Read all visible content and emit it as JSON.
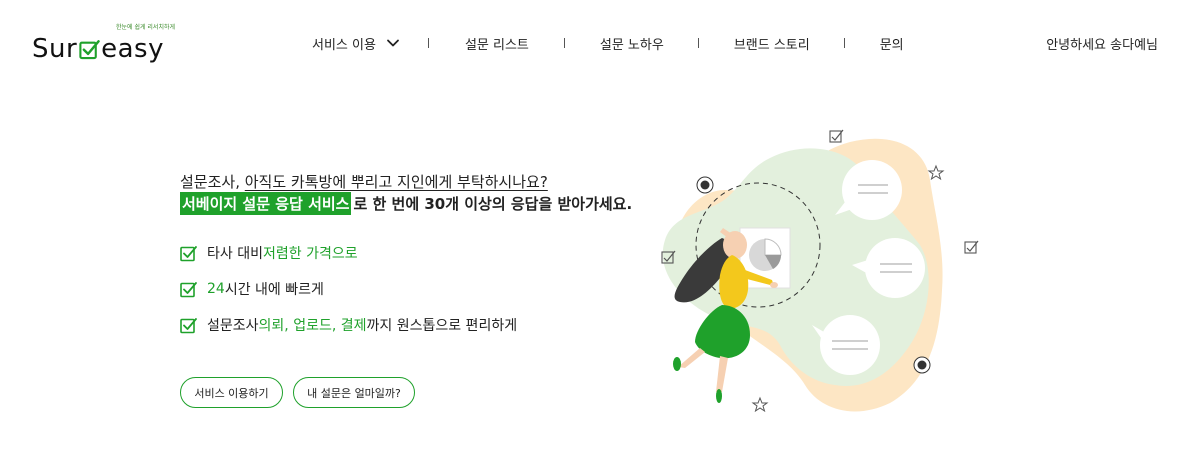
{
  "logo": {
    "part1": "Sur",
    "part2": "easy",
    "tagline": "한눈에 쉽게 리서치하게"
  },
  "nav": {
    "items": [
      {
        "label": "서비스 이용",
        "has_dropdown": true
      },
      {
        "label": "설문 리스트"
      },
      {
        "label": "설문 노하우"
      },
      {
        "label": "브랜드 스토리"
      },
      {
        "label": "문의"
      }
    ]
  },
  "greeting": "안녕하세요 송다예님",
  "hero": {
    "line1_prefix": "설문조사, ",
    "line1_underlined": "아직도 카톡방에 뿌리고 지인에게 부탁하시나요?",
    "line2_highlight": "서베이지 설문 응답 서비스",
    "line2_rest": "로 한 번에 30개 이상의 응답을 받아가세요."
  },
  "features": [
    {
      "plain_before": "타사 대비 ",
      "green": "저렴한 가격으로",
      "plain_after": ""
    },
    {
      "plain_before": "",
      "green": "24",
      "plain_after": " 시간 내에 빠르게"
    },
    {
      "plain_before": "설문조사 ",
      "green": "의뢰, 업로드, 결제",
      "plain_after": "까지 원스톱으로 편리하게"
    }
  ],
  "buttons": {
    "use_service": "서비스 이용하기",
    "price_check": "내 설문은 얼마일까?"
  },
  "colors": {
    "brand_green": "#1fa12b",
    "blob_green": "#e3f0dd",
    "blob_orange": "#fde6c4",
    "figure_yellow": "#f3c81c"
  }
}
